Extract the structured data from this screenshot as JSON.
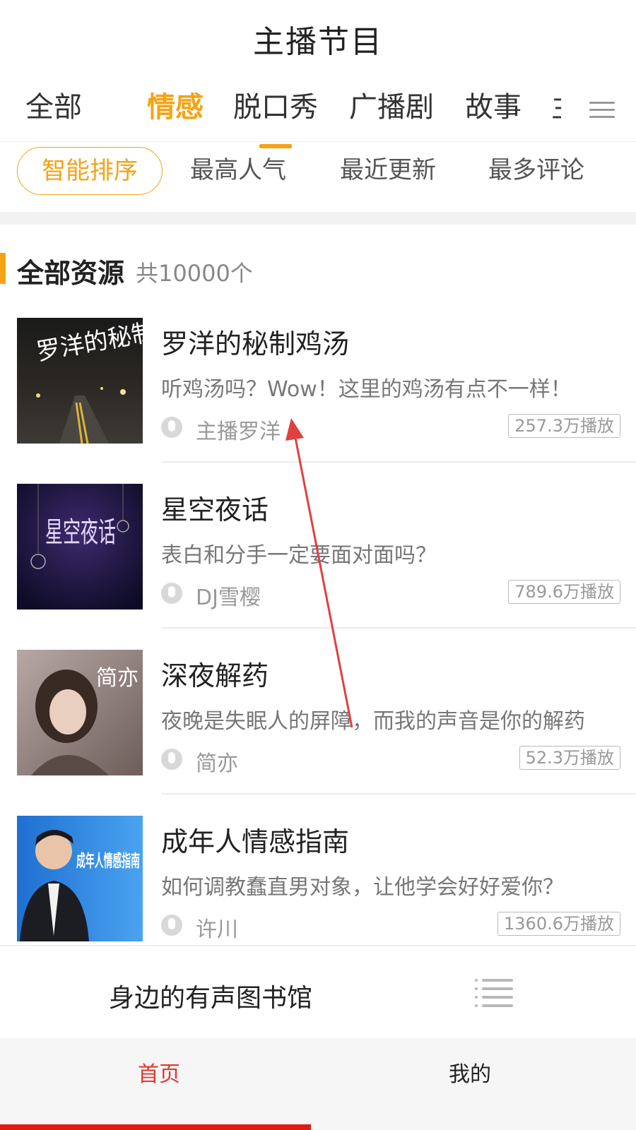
{
  "header": {
    "title": "主播节目"
  },
  "tabs": [
    {
      "label": "全部"
    },
    {
      "label": "情感",
      "active": true
    },
    {
      "label": "脱口秀"
    },
    {
      "label": "广播剧"
    },
    {
      "label": "故事"
    },
    {
      "label": "主"
    }
  ],
  "sort": [
    {
      "label": "智能排序",
      "active": true
    },
    {
      "label": "最高人气"
    },
    {
      "label": "最近更新"
    },
    {
      "label": "最多评论"
    }
  ],
  "section": {
    "title": "全部资源",
    "count": "共10000个"
  },
  "items": [
    {
      "title": "罗洋的秘制鸡汤",
      "desc": "听鸡汤吗？Wow！这里的鸡汤有点不一样！",
      "host": "主播罗洋",
      "plays": "257.3万播放",
      "cover_text": "罗洋的秘制鸡汤"
    },
    {
      "title": "星空夜话",
      "desc": "表白和分手一定要面对面吗？",
      "host": "DJ雪樱",
      "plays": "789.6万播放",
      "cover_text": "星空夜话"
    },
    {
      "title": "深夜解药",
      "desc": "夜晚是失眠人的屏障，而我的声音是你的解药",
      "host": "简亦",
      "plays": "52.3万播放",
      "cover_text": "简亦"
    },
    {
      "title": "成年人情感指南",
      "desc": "如何调教蠢直男对象，让他学会好好爱你？",
      "host": "许川",
      "plays": "1360.6万播放",
      "cover_text": "成年人情感指南"
    }
  ],
  "banner": {
    "text": "身边的有声图书馆"
  },
  "tabbar": [
    {
      "label": "首页",
      "active": true
    },
    {
      "label": "我的"
    }
  ],
  "colors": {
    "accent": "#f5a315",
    "tab_active": "#e03a2f",
    "indicator": "#e21a12"
  }
}
